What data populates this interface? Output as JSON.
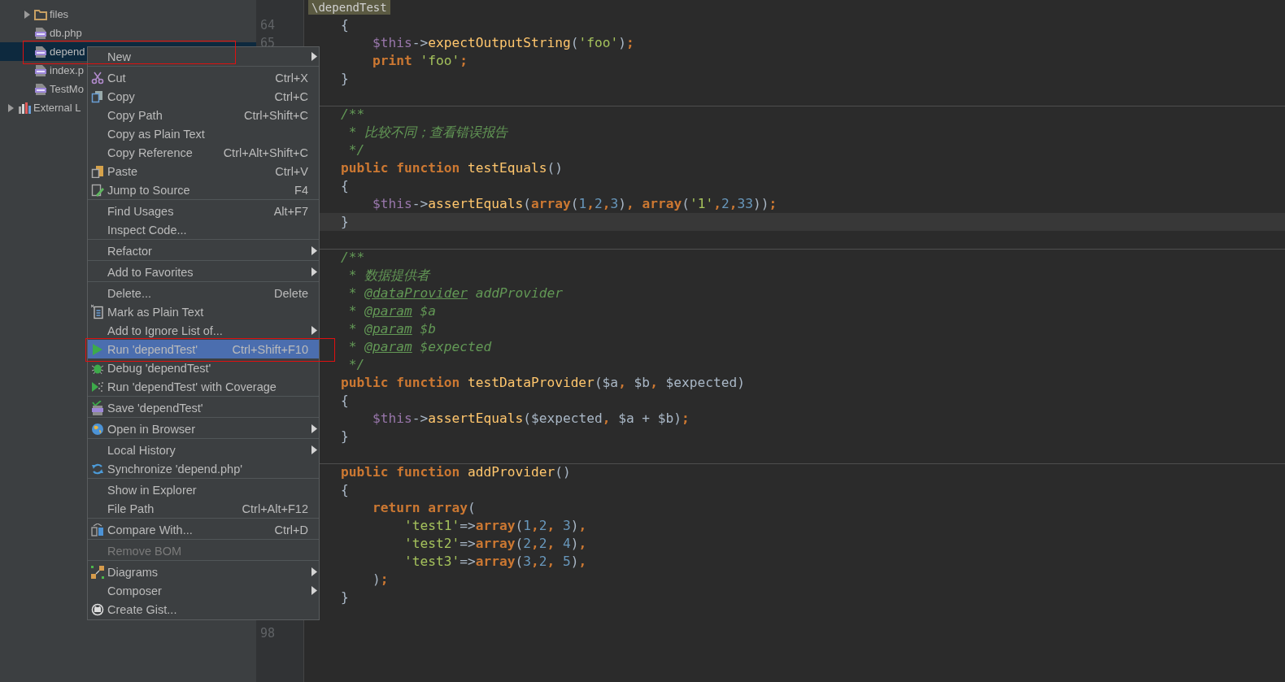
{
  "tree": [
    {
      "label": "files",
      "kind": "folder",
      "expanded": false,
      "selected": false
    },
    {
      "label": "db.php",
      "kind": "php",
      "selected": false
    },
    {
      "label": "depend",
      "kind": "php",
      "selected": true
    },
    {
      "label": "index.p",
      "kind": "php",
      "selected": false
    },
    {
      "label": "TestMo",
      "kind": "php",
      "selected": false
    },
    {
      "label": "External L",
      "kind": "library",
      "expanded": false,
      "selected": false
    }
  ],
  "breadcrumb": "\\dependTest",
  "code": [
    {
      "number": "64",
      "tokens": [
        {
          "kind": "plain",
          "text": "{"
        }
      ]
    },
    {
      "number": "65",
      "tokens": [
        {
          "kind": "var",
          "text": "    $this"
        },
        {
          "kind": "plain",
          "text": "->"
        },
        {
          "kind": "fn",
          "text": "expectOutputString"
        },
        {
          "kind": "plain",
          "text": "("
        },
        {
          "kind": "str",
          "text": "'foo'"
        },
        {
          "kind": "plain",
          "text": ")"
        },
        {
          "kind": "kw",
          "text": ";"
        }
      ]
    },
    {
      "tokens": [
        {
          "kind": "kw",
          "text": "    print"
        },
        {
          "kind": "str",
          "text": " 'foo'"
        },
        {
          "kind": "kw",
          "text": ";"
        }
      ]
    },
    {
      "tokens": [
        {
          "kind": "plain",
          "text": "}"
        }
      ]
    },
    {
      "current": false,
      "separator": false
    },
    {
      "separator": true,
      "tokens": [
        {
          "kind": "comment",
          "text": "/**"
        }
      ]
    },
    {
      "tokens": [
        {
          "kind": "comment",
          "text": " * 比较不同；查看错误报告"
        }
      ]
    },
    {
      "tokens": [
        {
          "kind": "comment",
          "text": " */"
        }
      ]
    },
    {
      "tokens": [
        {
          "kind": "kw",
          "text": "public function"
        },
        {
          "kind": "fn",
          "text": " testEquals"
        },
        {
          "kind": "plain",
          "text": "()"
        }
      ]
    },
    {
      "tokens": [
        {
          "kind": "plain",
          "text": "{"
        }
      ]
    },
    {
      "tokens": [
        {
          "kind": "var",
          "text": "    $this"
        },
        {
          "kind": "plain",
          "text": "->"
        },
        {
          "kind": "fn",
          "text": "assertEquals"
        },
        {
          "kind": "plain",
          "text": "("
        },
        {
          "kind": "kw",
          "text": "array"
        },
        {
          "kind": "plain",
          "text": "("
        },
        {
          "kind": "num",
          "text": "1"
        },
        {
          "kind": "kw",
          "text": ","
        },
        {
          "kind": "num",
          "text": "2"
        },
        {
          "kind": "kw",
          "text": ","
        },
        {
          "kind": "num",
          "text": "3"
        },
        {
          "kind": "plain",
          "text": ")"
        },
        {
          "kind": "kw",
          "text": ", array"
        },
        {
          "kind": "plain",
          "text": "("
        },
        {
          "kind": "str",
          "text": "'1'"
        },
        {
          "kind": "kw",
          "text": ","
        },
        {
          "kind": "num",
          "text": "2"
        },
        {
          "kind": "kw",
          "text": ","
        },
        {
          "kind": "num",
          "text": "33"
        },
        {
          "kind": "plain",
          "text": "))"
        },
        {
          "kind": "kw",
          "text": ";"
        }
      ]
    },
    {
      "current": true,
      "tokens": [
        {
          "kind": "plain",
          "text": "}"
        }
      ]
    },
    {
      "current": false,
      "separator": false
    },
    {
      "separator": true,
      "tokens": [
        {
          "kind": "comment",
          "text": "/**"
        }
      ]
    },
    {
      "tokens": [
        {
          "kind": "comment",
          "text": " * 数据提供者"
        }
      ]
    },
    {
      "tokens": [
        {
          "kind": "comment",
          "text": " * "
        },
        {
          "kind": "doctag",
          "text": "@dataProvider"
        },
        {
          "kind": "comment",
          "text": " addProvider"
        }
      ]
    },
    {
      "tokens": [
        {
          "kind": "comment",
          "text": " * "
        },
        {
          "kind": "doctag",
          "text": "@param"
        },
        {
          "kind": "comment",
          "text": " $a"
        }
      ]
    },
    {
      "tokens": [
        {
          "kind": "comment",
          "text": " * "
        },
        {
          "kind": "doctag",
          "text": "@param"
        },
        {
          "kind": "comment",
          "text": " $b"
        }
      ]
    },
    {
      "tokens": [
        {
          "kind": "comment",
          "text": " * "
        },
        {
          "kind": "doctag",
          "text": "@param"
        },
        {
          "kind": "comment",
          "text": " $expected"
        }
      ]
    },
    {
      "tokens": [
        {
          "kind": "comment",
          "text": " */"
        }
      ]
    },
    {
      "tokens": [
        {
          "kind": "kw",
          "text": "public function"
        },
        {
          "kind": "fn",
          "text": " testDataProvider"
        },
        {
          "kind": "plain",
          "text": "($a"
        },
        {
          "kind": "kw",
          "text": ","
        },
        {
          "kind": "plain",
          "text": " $b"
        },
        {
          "kind": "kw",
          "text": ","
        },
        {
          "kind": "plain",
          "text": " $expected)"
        }
      ]
    },
    {
      "tokens": [
        {
          "kind": "plain",
          "text": "{"
        }
      ]
    },
    {
      "tokens": [
        {
          "kind": "var",
          "text": "    $this"
        },
        {
          "kind": "plain",
          "text": "->"
        },
        {
          "kind": "fn",
          "text": "assertEquals"
        },
        {
          "kind": "plain",
          "text": "($expected"
        },
        {
          "kind": "kw",
          "text": ","
        },
        {
          "kind": "plain",
          "text": " $a + $b)"
        },
        {
          "kind": "kw",
          "text": ";"
        }
      ]
    },
    {
      "tokens": [
        {
          "kind": "plain",
          "text": "}"
        }
      ]
    },
    {
      "current": false,
      "separator": false
    },
    {
      "separator": true,
      "tokens": [
        {
          "kind": "kw",
          "text": "public function"
        },
        {
          "kind": "fn",
          "text": " addProvider"
        },
        {
          "kind": "plain",
          "text": "()"
        }
      ]
    },
    {
      "tokens": [
        {
          "kind": "plain",
          "text": "{"
        }
      ]
    },
    {
      "tokens": [
        {
          "kind": "kw",
          "text": "    return array"
        },
        {
          "kind": "plain",
          "text": "("
        }
      ]
    },
    {
      "tokens": [
        {
          "kind": "str",
          "text": "        'test1'"
        },
        {
          "kind": "plain",
          "text": "=>"
        },
        {
          "kind": "kw",
          "text": "array"
        },
        {
          "kind": "plain",
          "text": "("
        },
        {
          "kind": "num",
          "text": "1"
        },
        {
          "kind": "kw",
          "text": ","
        },
        {
          "kind": "num",
          "text": "2"
        },
        {
          "kind": "kw",
          "text": ","
        },
        {
          "kind": "num",
          "text": " 3"
        },
        {
          "kind": "plain",
          "text": ")"
        },
        {
          "kind": "kw",
          "text": ","
        }
      ]
    },
    {
      "tokens": [
        {
          "kind": "str",
          "text": "        'test2'"
        },
        {
          "kind": "plain",
          "text": "=>"
        },
        {
          "kind": "kw",
          "text": "array"
        },
        {
          "kind": "plain",
          "text": "("
        },
        {
          "kind": "num",
          "text": "2"
        },
        {
          "kind": "kw",
          "text": ","
        },
        {
          "kind": "num",
          "text": "2"
        },
        {
          "kind": "kw",
          "text": ","
        },
        {
          "kind": "num",
          "text": " 4"
        },
        {
          "kind": "plain",
          "text": ")"
        },
        {
          "kind": "kw",
          "text": ","
        }
      ]
    },
    {
      "tokens": [
        {
          "kind": "str",
          "text": "        'test3'"
        },
        {
          "kind": "plain",
          "text": "=>"
        },
        {
          "kind": "kw",
          "text": "array"
        },
        {
          "kind": "plain",
          "text": "("
        },
        {
          "kind": "num",
          "text": "3"
        },
        {
          "kind": "kw",
          "text": ","
        },
        {
          "kind": "num",
          "text": "2"
        },
        {
          "kind": "kw",
          "text": ","
        },
        {
          "kind": "num",
          "text": " 5"
        },
        {
          "kind": "plain",
          "text": ")"
        },
        {
          "kind": "kw",
          "text": ","
        }
      ]
    },
    {
      "tokens": [
        {
          "kind": "plain",
          "text": "    )"
        },
        {
          "kind": "kw",
          "text": ";"
        }
      ]
    },
    {
      "tokens": [
        {
          "kind": "plain",
          "text": "}"
        }
      ]
    },
    {
      "current": false,
      "separator": false
    },
    {
      "number": "98"
    }
  ],
  "menu": [
    {
      "label": "New",
      "submenu": true,
      "disabled": false,
      "selected": false,
      "separator_before": false
    },
    {
      "label": "Cut",
      "shortcut": "Ctrl+X",
      "kind": "scissors",
      "submenu": false,
      "disabled": false,
      "selected": false,
      "separator_before": true
    },
    {
      "label": "Copy",
      "shortcut": "Ctrl+C",
      "kind": "copy",
      "submenu": false,
      "disabled": false,
      "selected": false,
      "separator_before": false
    },
    {
      "label": "Copy Path",
      "shortcut": "Ctrl+Shift+C",
      "submenu": false,
      "disabled": false,
      "selected": false,
      "separator_before": false
    },
    {
      "label": "Copy as Plain Text",
      "submenu": false,
      "disabled": false,
      "selected": false,
      "separator_before": false
    },
    {
      "label": "Copy Reference",
      "shortcut": "Ctrl+Alt+Shift+C",
      "submenu": false,
      "disabled": false,
      "selected": false,
      "separator_before": false
    },
    {
      "label": "Paste",
      "shortcut": "Ctrl+V",
      "kind": "paste",
      "submenu": false,
      "disabled": false,
      "selected": false,
      "separator_before": false
    },
    {
      "label": "Jump to Source",
      "shortcut": "F4",
      "kind": "edit",
      "submenu": false,
      "disabled": false,
      "selected": false,
      "separator_before": false
    },
    {
      "label": "Find Usages",
      "shortcut": "Alt+F7",
      "submenu": false,
      "disabled": false,
      "selected": false,
      "separator_before": true
    },
    {
      "label": "Inspect Code...",
      "submenu": false,
      "disabled": false,
      "selected": false,
      "separator_before": false
    },
    {
      "label": "Refactor",
      "submenu": true,
      "disabled": false,
      "selected": false,
      "separator_before": true
    },
    {
      "label": "Add to Favorites",
      "submenu": true,
      "disabled": false,
      "selected": false,
      "separator_before": true
    },
    {
      "label": "Delete...",
      "shortcut": "Delete",
      "submenu": false,
      "disabled": false,
      "selected": false,
      "separator_before": true
    },
    {
      "label": "Mark as Plain Text",
      "kind": "textfile",
      "submenu": false,
      "disabled": false,
      "selected": false,
      "separator_before": false
    },
    {
      "label": "Add to Ignore List of...",
      "submenu": true,
      "disabled": false,
      "selected": false,
      "separator_before": false
    },
    {
      "label": "Run 'dependTest'",
      "shortcut": "Ctrl+Shift+F10",
      "kind": "run",
      "submenu": false,
      "disabled": false,
      "selected": true,
      "separator_before": false
    },
    {
      "label": "Debug 'dependTest'",
      "kind": "debug",
      "submenu": false,
      "disabled": false,
      "selected": false,
      "separator_before": false
    },
    {
      "label": "Run 'dependTest' with Coverage",
      "kind": "coverage",
      "submenu": false,
      "disabled": false,
      "selected": false,
      "separator_before": false
    },
    {
      "label": "Save 'dependTest'",
      "kind": "save",
      "submenu": false,
      "disabled": false,
      "selected": false,
      "separator_before": true
    },
    {
      "label": "Open in Browser",
      "kind": "globe",
      "submenu": true,
      "disabled": false,
      "selected": false,
      "separator_before": true
    },
    {
      "label": "Local History",
      "submenu": true,
      "disabled": false,
      "selected": false,
      "separator_before": true
    },
    {
      "label": "Synchronize 'depend.php'",
      "kind": "sync",
      "submenu": false,
      "disabled": false,
      "selected": false,
      "separator_before": false
    },
    {
      "label": "Show in Explorer",
      "submenu": false,
      "disabled": false,
      "selected": false,
      "separator_before": true
    },
    {
      "label": "File Path",
      "shortcut": "Ctrl+Alt+F12",
      "submenu": false,
      "disabled": false,
      "selected": false,
      "separator_before": false
    },
    {
      "label": "Compare With...",
      "shortcut": "Ctrl+D",
      "kind": "compare",
      "submenu": false,
      "disabled": false,
      "selected": false,
      "separator_before": true
    },
    {
      "label": "Remove BOM",
      "submenu": false,
      "disabled": true,
      "selected": false,
      "separator_before": true
    },
    {
      "label": "Diagrams",
      "kind": "diagram",
      "submenu": true,
      "disabled": false,
      "selected": false,
      "separator_before": true
    },
    {
      "label": "Composer",
      "submenu": true,
      "disabled": false,
      "selected": false,
      "separator_before": false
    },
    {
      "label": "Create Gist...",
      "kind": "gist",
      "submenu": false,
      "disabled": false,
      "selected": false,
      "separator_before": false
    }
  ]
}
